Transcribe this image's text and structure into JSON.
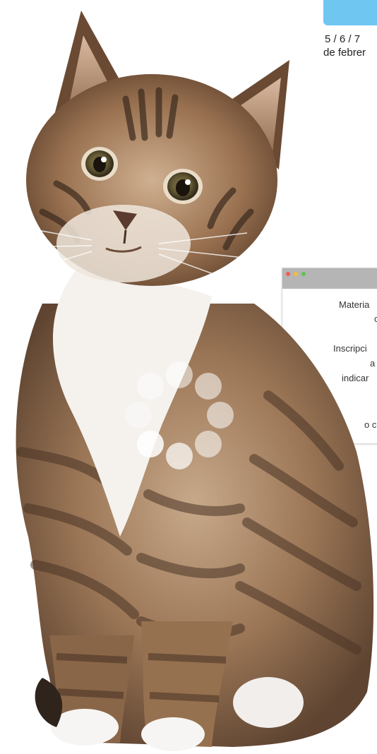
{
  "header": {
    "date_line1": "5 / 6 / 7",
    "date_line2": "de febrer"
  },
  "info_window": {
    "line1": "Materia",
    "line2": "c",
    "line3": "Inscripci",
    "line4": "a",
    "line5": "indicar",
    "line6": "o c"
  },
  "colors": {
    "accent": "#6ec6f1",
    "window_bar": "#b5b5b5"
  },
  "icons": {
    "spinner": "loading-spinner-icon",
    "window_controls": [
      "close-dot-icon",
      "minimize-dot-icon",
      "maximize-dot-icon"
    ]
  }
}
